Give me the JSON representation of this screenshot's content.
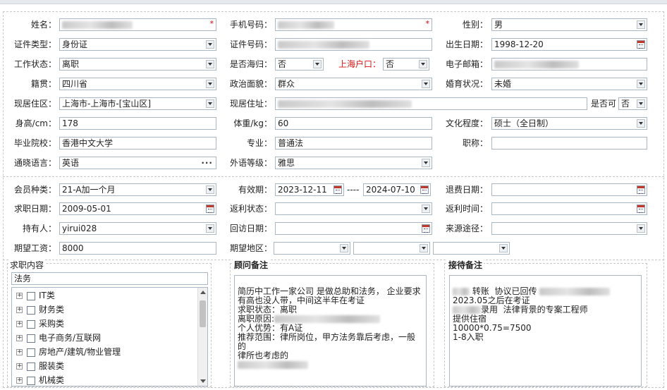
{
  "form": {
    "name": {
      "label": "姓名：",
      "value": ""
    },
    "phone": {
      "label": "手机号码：",
      "value": ""
    },
    "gender": {
      "label": "性别：",
      "value": "男"
    },
    "id_type": {
      "label": "证件类型：",
      "value": "身份证"
    },
    "id_number": {
      "label": "证件号码：",
      "value": ""
    },
    "birth_date": {
      "label": "出生日期：",
      "value": "1998-12-20"
    },
    "work_status": {
      "label": "工作状态：",
      "value": "离职"
    },
    "returnee": {
      "label": "是否海归：",
      "value": "否"
    },
    "shanghai_hukou": {
      "label": "上海户口：",
      "value": "否"
    },
    "email": {
      "label": "电子邮箱：",
      "value": ""
    },
    "native_place": {
      "label": "籍贯：",
      "value": "四川省"
    },
    "political": {
      "label": "政治面貌：",
      "value": "群众"
    },
    "marital": {
      "label": "婚育状况：",
      "value": "未婚"
    },
    "residence_area": {
      "label": "现居住区：",
      "value": "上海市-上海市-[宝山区]"
    },
    "residence_addr": {
      "label": "现居住址：",
      "value": ""
    },
    "residence_flag": {
      "label": "是否可",
      "value": "否"
    },
    "height": {
      "label": "身高/cm：",
      "value": "178"
    },
    "weight": {
      "label": "体重/kg：",
      "value": "60"
    },
    "education": {
      "label": "文化程度：",
      "value": "硕士（全日制）"
    },
    "school": {
      "label": "毕业院校：",
      "value": "香港中文大学"
    },
    "major": {
      "label": "专业：",
      "value": "普通法"
    },
    "title": {
      "label": "职称：",
      "value": ""
    },
    "languages": {
      "label": "通晓语言：",
      "value": "英语"
    },
    "foreign_level": {
      "label": "外语等级：",
      "value": "雅思"
    }
  },
  "membership": {
    "member_type": {
      "label": "会员种类：",
      "value": "21-A加一个月"
    },
    "validity": {
      "label": "有效期：",
      "start": "2023-12-11",
      "sep": "----",
      "end": "2024-07-10"
    },
    "refund_date": {
      "label": "退费日期：",
      "value": ""
    },
    "job_date": {
      "label": "求职日期：",
      "value": "2009-05-01"
    },
    "rebate_status": {
      "label": "返利状态：",
      "value": ""
    },
    "rebate_time": {
      "label": "返利时间：",
      "value": ""
    },
    "holder": {
      "label": "持有人：",
      "value": "yirui028"
    },
    "visit_date": {
      "label": "回访日期：",
      "value": ""
    },
    "source": {
      "label": "来源途径：",
      "value": ""
    },
    "expected_salary": {
      "label": "期望工资：",
      "value": "8000"
    },
    "expected_region": {
      "label": "期望地区：",
      "values": [
        "",
        "",
        ""
      ]
    }
  },
  "job_content": {
    "title": "求职内容",
    "search_value": "法务",
    "categories": [
      "IT类",
      "财务类",
      "采购类",
      "电子商务/互联网",
      "房地产/建筑/物业管理",
      "服装类",
      "机械类"
    ]
  },
  "consultant_notes": {
    "title": "顾问备注",
    "lines": [
      "",
      "简历中工作一家公司 是做总助和法务， 企业要求",
      "有高也没人带，中间这半年在考证",
      "",
      "求职状态：离职",
      "离职原因:",
      "个人优势：有A证",
      "推荐范围：律所岗位，甲方法务靠后考虑，一般的",
      "律所也考虑的"
    ]
  },
  "reception_notes": {
    "title": "接待备注",
    "lines": [
      "转账  协议已回传",
      "",
      "2023.05之后在考证",
      "",
      "录用  法律背景的专案工程师",
      "提供住宿",
      "10000*0.75=7500",
      "1-8入职"
    ]
  }
}
